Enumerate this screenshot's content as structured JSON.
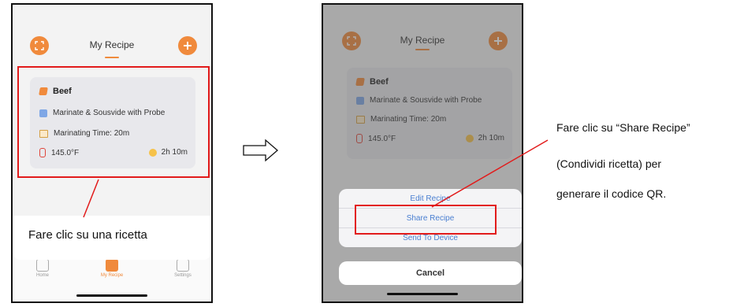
{
  "screen1": {
    "header_title": "My Recipe",
    "recipe": {
      "name": "Beef",
      "mode": "Marinate & Sousvide with Probe",
      "marinating_time": "Marinating Time: 20m",
      "temperature": "145.0°F",
      "duration": "2h 10m"
    },
    "tabs": [
      {
        "label": "Home"
      },
      {
        "label": "My Recipe"
      },
      {
        "label": "Settings"
      }
    ],
    "caption": "Fare clic su una ricetta"
  },
  "screen2": {
    "header_title": "My Recipe",
    "recipe": {
      "name": "Beef",
      "mode": "Marinate & Sousvide with Probe",
      "marinating_time": "Marinating Time: 20m",
      "temperature": "145.0°F",
      "duration": "2h 10m"
    },
    "actions": [
      {
        "label": "Edit Recipe"
      },
      {
        "label": "Share Recipe"
      },
      {
        "label": "Send To Device"
      }
    ],
    "cancel_label": "Cancel"
  },
  "instructions": {
    "line1": "Fare clic su “Share Recipe”",
    "line2": "(Condividi ricetta) per",
    "line3": "generare il codice QR."
  },
  "colors": {
    "accent": "#f08a3c",
    "highlight": "#e21b1b",
    "link": "#4a7fd1"
  }
}
